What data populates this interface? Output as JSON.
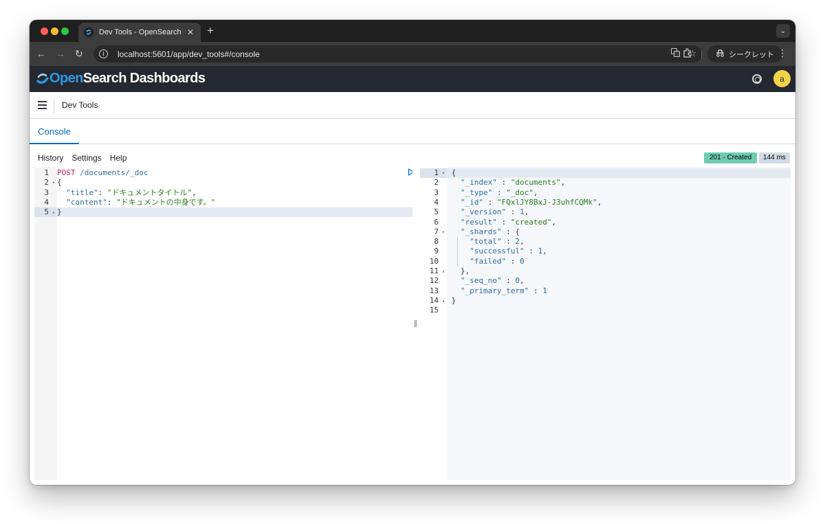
{
  "browser": {
    "tab_title": "Dev Tools - OpenSearch",
    "url": "localhost:5601/app/dev_tools#/console",
    "incognito_label": "シークレット"
  },
  "osd": {
    "logo_open": "Open",
    "logo_rest": "Search Dashboards",
    "avatar_initial": "a"
  },
  "app": {
    "title": "Dev Tools",
    "tab_console": "Console",
    "menu": [
      "History",
      "Settings",
      "Help"
    ],
    "status_badge": "201 - Created",
    "time_badge": "144 ms"
  },
  "request": {
    "method": "POST",
    "path": " /documents/_doc",
    "body": [
      {
        "key": "\"title\"",
        "value": "\"ドキュメントタイトル\""
      },
      {
        "key": "\"content\"",
        "value": "\"ドキュメントの中身です。\""
      }
    ]
  },
  "response": {
    "index": "\"documents\"",
    "type": "\"_doc\"",
    "id": "\"FQxlJY8BxJ-J3uhfCQMk\"",
    "version": "1",
    "result": "\"created\"",
    "shards_total": "2",
    "shards_successful": "1",
    "shards_failed": "0",
    "seq_no": "0",
    "primary_term": "1"
  },
  "colors": {
    "accent": "#006bb8",
    "status_green": "#6dccb1",
    "header_dark": "#25282f"
  }
}
